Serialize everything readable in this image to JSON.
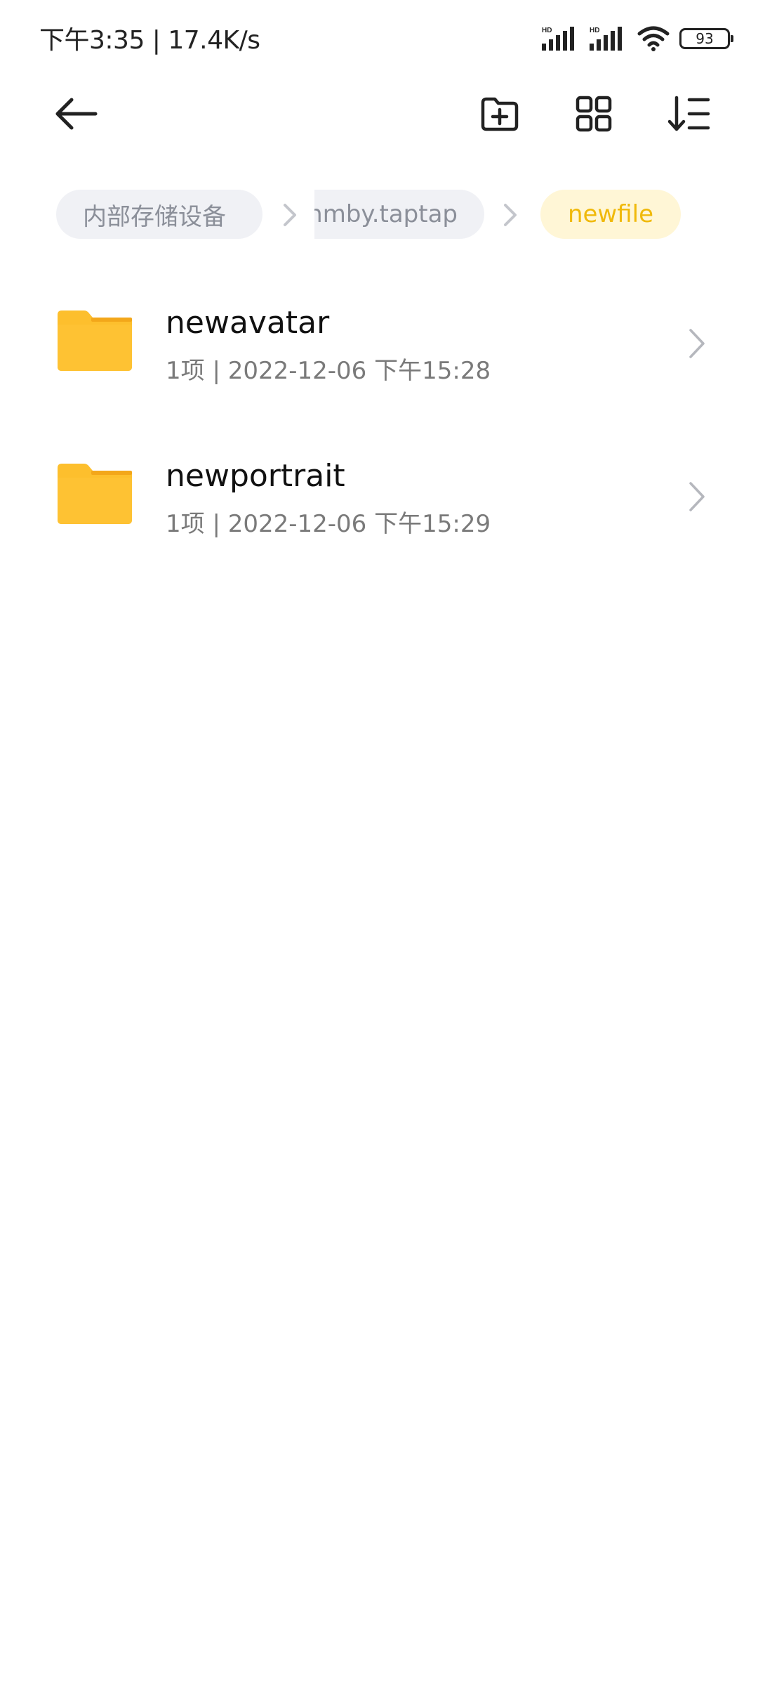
{
  "status_bar": {
    "time_speed": "下午3:35 | 17.4K/s",
    "network_1": "HD",
    "network_2": "HD",
    "battery": "93"
  },
  "toolbar": {
    "back_icon": "arrow-left-icon",
    "new_folder_icon": "folder-plus-icon",
    "view_icon": "grid-icon",
    "sort_icon": "sort-icon"
  },
  "breadcrumb": {
    "items": [
      {
        "label": "内部存储设备"
      },
      {
        "label": "nmby.taptap"
      },
      {
        "label": "newfile"
      }
    ]
  },
  "accent_colors": {
    "folder": "#fdbf2d",
    "folder_tab": "#f3a71a",
    "current_crumb_bg": "#fff6d6",
    "current_crumb_text": "#f0b90b"
  },
  "files": [
    {
      "name": "newavatar",
      "meta": "1项 | 2022-12-06 下午15:28",
      "icon": "folder-icon"
    },
    {
      "name": "newportrait",
      "meta": "1项 | 2022-12-06 下午15:29",
      "icon": "folder-icon"
    }
  ]
}
